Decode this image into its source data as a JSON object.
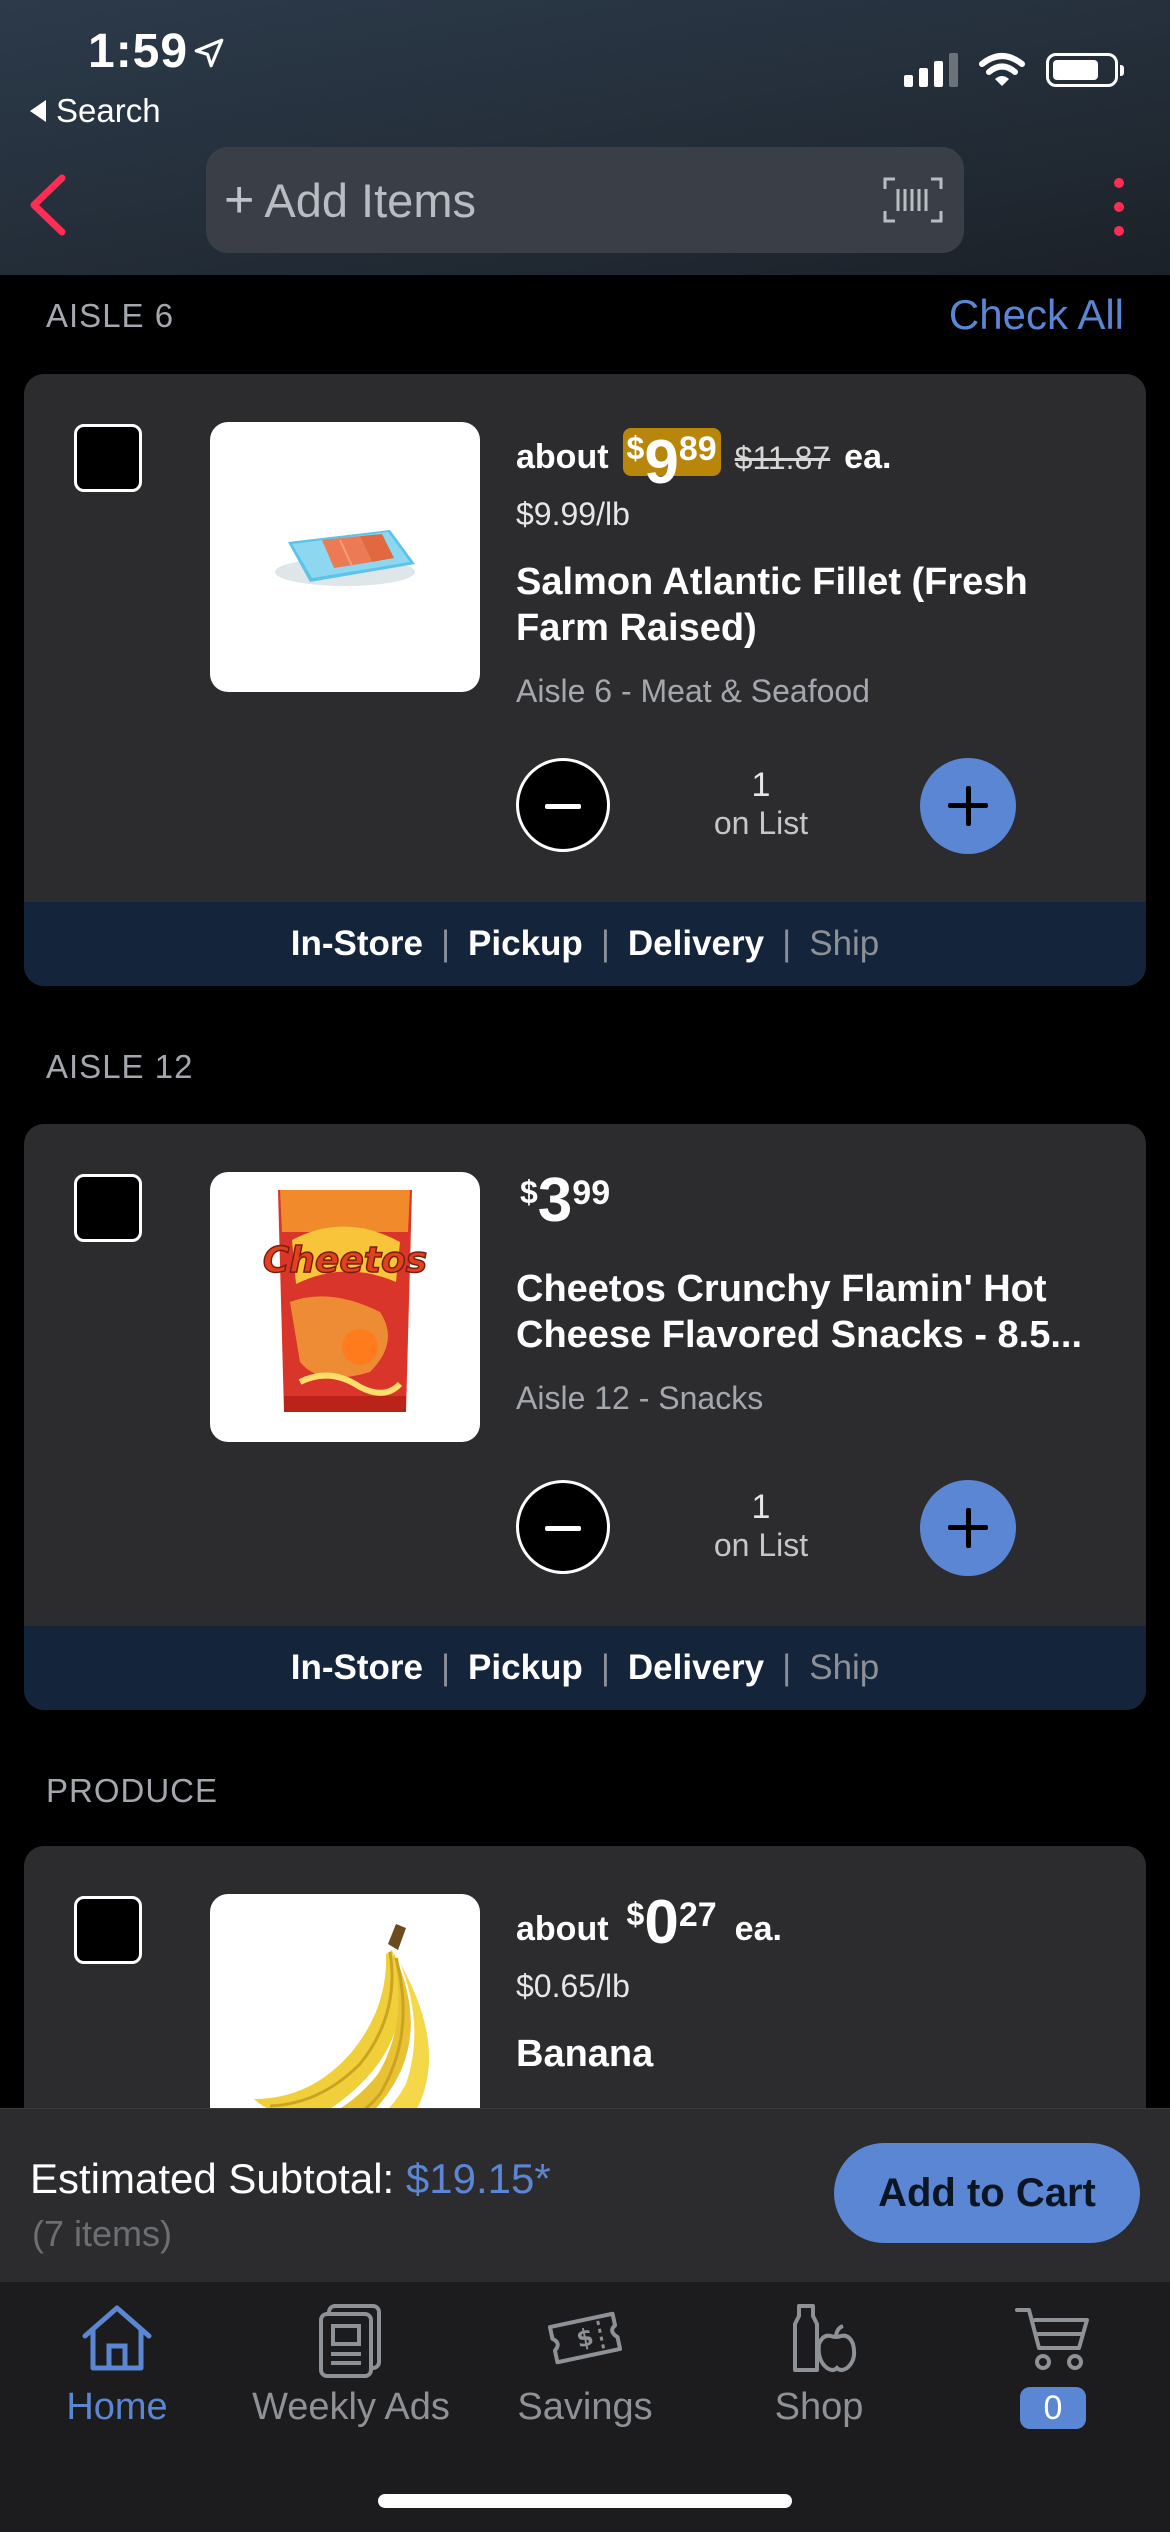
{
  "status_bar": {
    "time": "1:59",
    "back_app": "Search"
  },
  "search": {
    "placeholder": "Add Items"
  },
  "list": {
    "check_all": "Check All",
    "sections": [
      {
        "label": "AISLE 6",
        "item": {
          "about": "about",
          "price_dollar": "$",
          "price_whole": "9",
          "price_cents": "89",
          "price_sale": true,
          "original_price": "$11.87",
          "ea": "ea.",
          "unit_price": "$9.99/lb",
          "name": "Salmon Atlantic Fillet (Fresh Farm Raised)",
          "aisle": "Aisle 6 - Meat & Seafood",
          "qty": "1",
          "qty_label": "on List"
        }
      },
      {
        "label": "AISLE 12",
        "item": {
          "price_dollar": "$",
          "price_whole": "3",
          "price_cents": "99",
          "name": "Cheetos Crunchy Flamin' Hot Cheese Flavored Snacks - 8.5...",
          "aisle": "Aisle 12 - Snacks",
          "qty": "1",
          "qty_label": "on List"
        }
      },
      {
        "label": "PRODUCE",
        "item": {
          "about": "about",
          "price_dollar": "$",
          "price_whole": "0",
          "price_cents": "27",
          "ea": "ea.",
          "unit_price": "$0.65/lb",
          "name": "Banana"
        }
      }
    ],
    "fulfillment": {
      "instore": "In-Store",
      "pickup": "Pickup",
      "delivery": "Delivery",
      "ship": "Ship",
      "sep": "|"
    }
  },
  "subtotal": {
    "label": "Estimated Subtotal:",
    "amount": "$19.15*",
    "items": "(7 items)",
    "button": "Add to Cart"
  },
  "tabs": {
    "home": "Home",
    "weekly_ads": "Weekly Ads",
    "savings": "Savings",
    "shop": "Shop",
    "cart_count": "0"
  },
  "colors": {
    "accent": "#5b86d3",
    "sale": "#b8860b",
    "alert": "#ff2d55",
    "card": "#2c2c2e",
    "fulfill_bar": "#14243a"
  }
}
